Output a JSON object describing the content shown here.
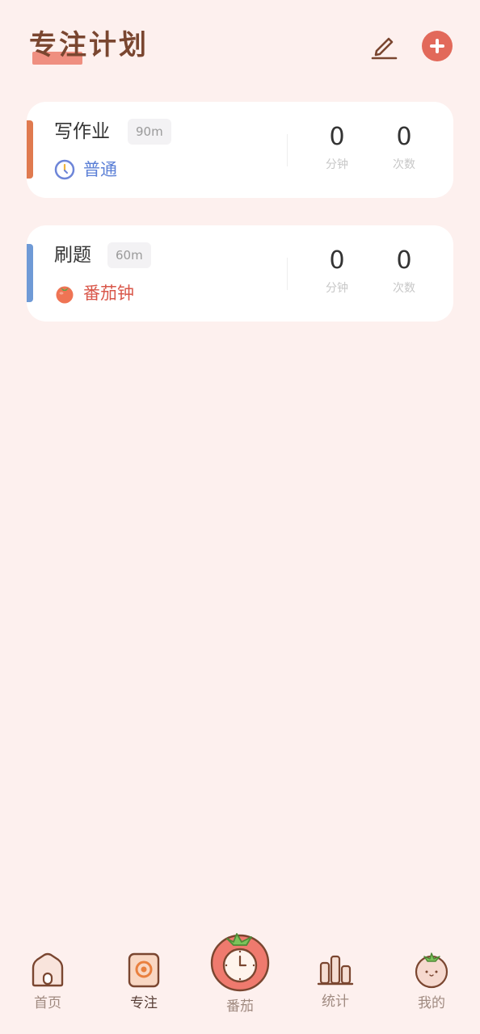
{
  "header": {
    "title": "专注计划",
    "edit_icon": "edit-pencil-icon",
    "add_icon": "plus-circle-icon"
  },
  "plans": [
    {
      "name": "写作业",
      "duration": "90m",
      "mode": "普通",
      "mode_icon": "clock-icon",
      "accent": "#e07a4f",
      "mode_color": "#5b7fd6",
      "minutes": "0",
      "minutes_label": "分钟",
      "count": "0",
      "count_label": "次数"
    },
    {
      "name": "刷题",
      "duration": "60m",
      "mode": "番茄钟",
      "mode_icon": "tomato-icon",
      "accent": "#6f9ad6",
      "mode_color": "#d9574a",
      "minutes": "0",
      "minutes_label": "分钟",
      "count": "0",
      "count_label": "次数"
    }
  ],
  "tabbar": {
    "active": "专注",
    "items": [
      {
        "label": "首页",
        "icon": "home-icon"
      },
      {
        "label": "专注",
        "icon": "focus-icon"
      },
      {
        "label": "番茄",
        "icon": "tomato-clock-icon"
      },
      {
        "label": "统计",
        "icon": "bar-chart-icon"
      },
      {
        "label": "我的",
        "icon": "tomato-face-icon"
      }
    ]
  }
}
